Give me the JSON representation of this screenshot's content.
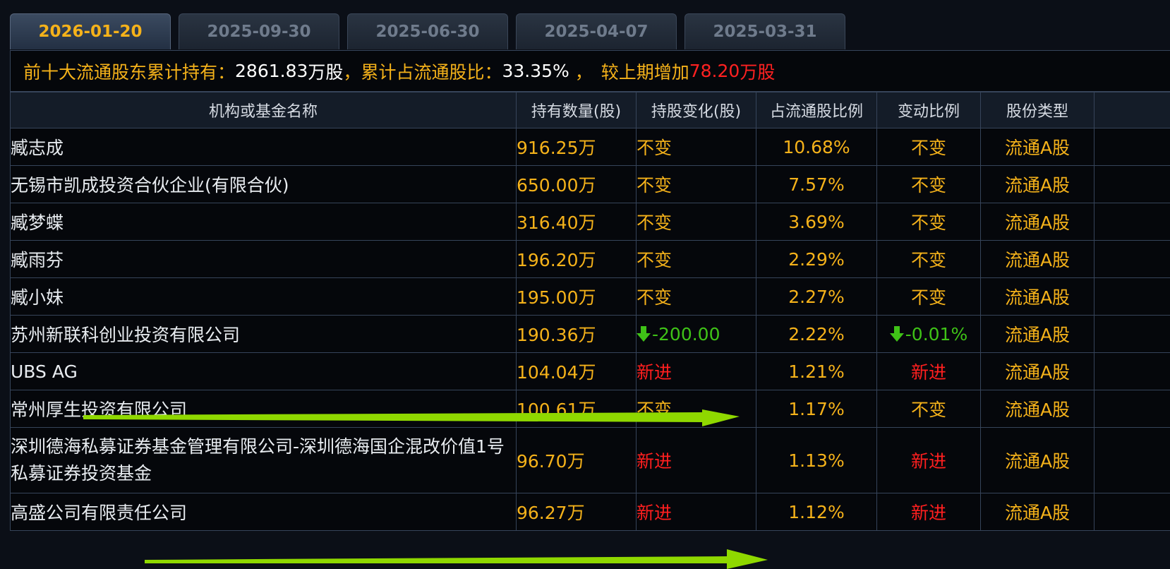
{
  "tabs": [
    "2026-01-20",
    "2025-09-30",
    "2025-06-30",
    "2025-04-07",
    "2025-03-31"
  ],
  "summary": {
    "label1": "前十大流通股东累计持有：",
    "value1": "2861.83",
    "unit1": "万股",
    "sep1": "，",
    "label2": "累计占流通股比：",
    "value2": "33.35%",
    "sep2": " ，",
    "label3": "较上期增加",
    "value3": "78.20",
    "unit3": "万股"
  },
  "columns": [
    "机构或基金名称",
    "持有数量(股)",
    "持股变化(股)",
    "占流通股比例",
    "变动比例",
    "股份类型"
  ],
  "rows": [
    {
      "name": "臧志成",
      "qty": "916.25万",
      "change": "不变",
      "pct": "10.68%",
      "ratio": "不变",
      "type": "流通A股"
    },
    {
      "name": "无锡市凯成投资合伙企业(有限合伙)",
      "qty": "650.00万",
      "change": "不变",
      "pct": "7.57%",
      "ratio": "不变",
      "type": "流通A股"
    },
    {
      "name": "臧梦蝶",
      "qty": "316.40万",
      "change": "不变",
      "pct": "3.69%",
      "ratio": "不变",
      "type": "流通A股"
    },
    {
      "name": "臧雨芬",
      "qty": "196.20万",
      "change": "不变",
      "pct": "2.29%",
      "ratio": "不变",
      "type": "流通A股"
    },
    {
      "name": "臧小妹",
      "qty": "195.00万",
      "change": "不变",
      "pct": "2.27%",
      "ratio": "不变",
      "type": "流通A股"
    },
    {
      "name": "苏州新联科创业投资有限公司",
      "qty": "190.36万",
      "change": "-200.00",
      "pct": "2.22%",
      "ratio": "-0.01%",
      "type": "流通A股"
    },
    {
      "name": "UBS AG",
      "qty": "104.04万",
      "change": "新进",
      "pct": "1.21%",
      "ratio": "新进",
      "type": "流通A股"
    },
    {
      "name": "常州厚生投资有限公司",
      "qty": "100.61万",
      "change": "不变",
      "pct": "1.17%",
      "ratio": "不变",
      "type": "流通A股"
    },
    {
      "name": "深圳德海私募证券基金管理有限公司-深圳德海国企混改价值1号私募证券投资基金",
      "qty": "96.70万",
      "change": "新进",
      "pct": "1.13%",
      "ratio": "新进",
      "type": "流通A股"
    },
    {
      "name": "高盛公司有限责任公司",
      "qty": "96.27万",
      "change": "新进",
      "pct": "1.12%",
      "ratio": "新进",
      "type": "流通A股"
    }
  ],
  "colors": {
    "accent": "#f5b21a",
    "new": "#ff1f1f",
    "down": "#3fc217",
    "annotation_arrow": "#8fd800"
  }
}
